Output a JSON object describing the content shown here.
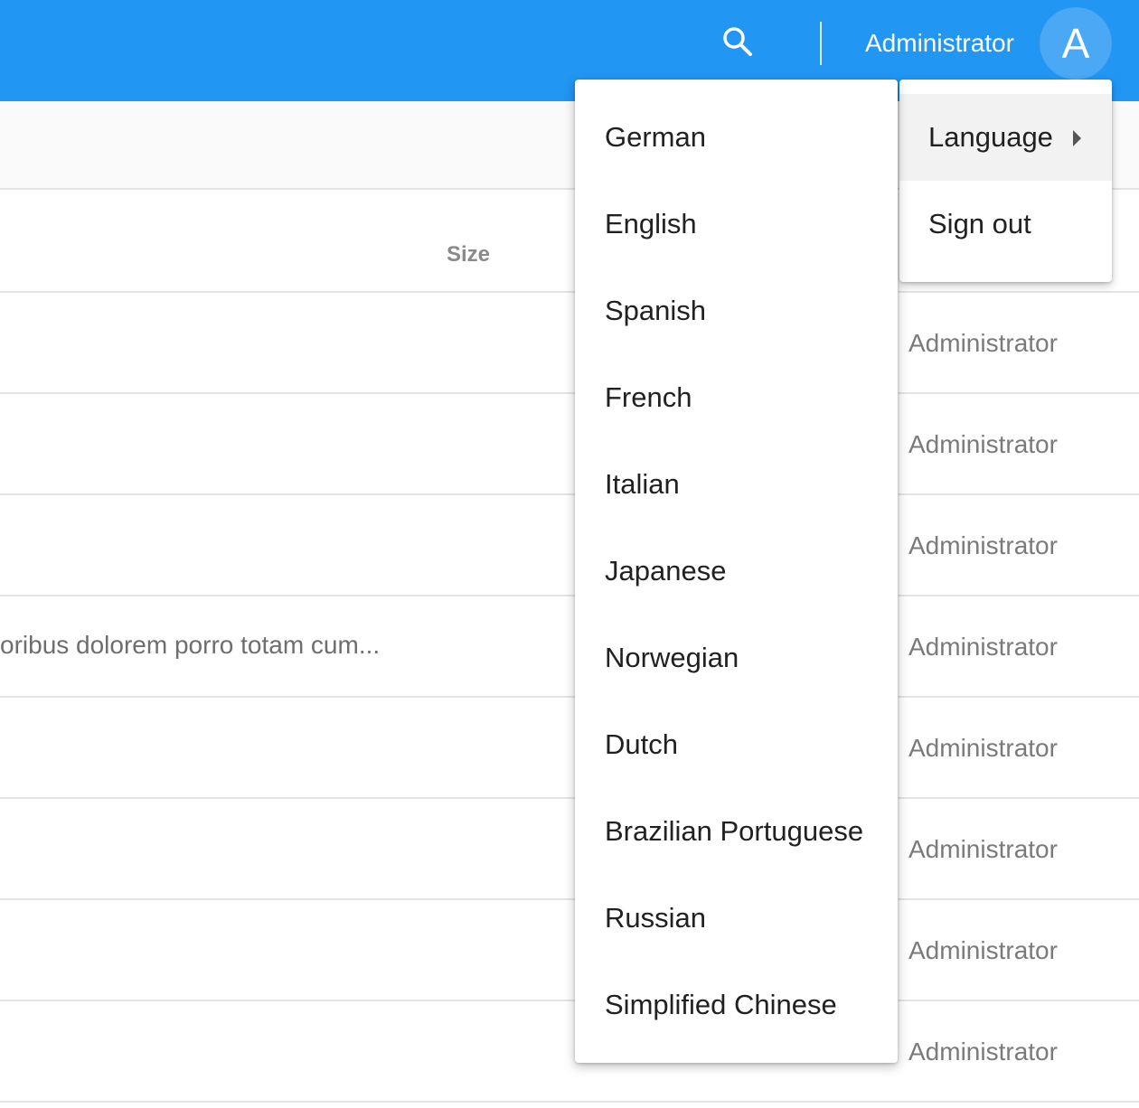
{
  "header": {
    "user_name": "Administrator",
    "avatar_initial": "A",
    "accent_color": "#2196f3"
  },
  "table": {
    "size_header": "Size",
    "rows": [
      {
        "description": "",
        "author": "Administrator"
      },
      {
        "description": "",
        "author": "Administrator"
      },
      {
        "description": "",
        "author": "Administrator"
      },
      {
        "description": "oribus dolorem porro totam cum...",
        "author": "Administrator"
      },
      {
        "description": "",
        "author": "Administrator"
      },
      {
        "description": "",
        "author": "Administrator"
      },
      {
        "description": "",
        "author": "Administrator"
      },
      {
        "description": "",
        "author": "Administrator"
      }
    ]
  },
  "user_menu": {
    "items": [
      {
        "label": "Language"
      },
      {
        "label": "Sign out"
      }
    ]
  },
  "language_menu": {
    "items": [
      {
        "label": "German"
      },
      {
        "label": "English"
      },
      {
        "label": "Spanish"
      },
      {
        "label": "French"
      },
      {
        "label": "Italian"
      },
      {
        "label": "Japanese"
      },
      {
        "label": "Norwegian"
      },
      {
        "label": "Dutch"
      },
      {
        "label": "Brazilian Portuguese"
      },
      {
        "label": "Russian"
      },
      {
        "label": "Simplified Chinese"
      }
    ]
  }
}
